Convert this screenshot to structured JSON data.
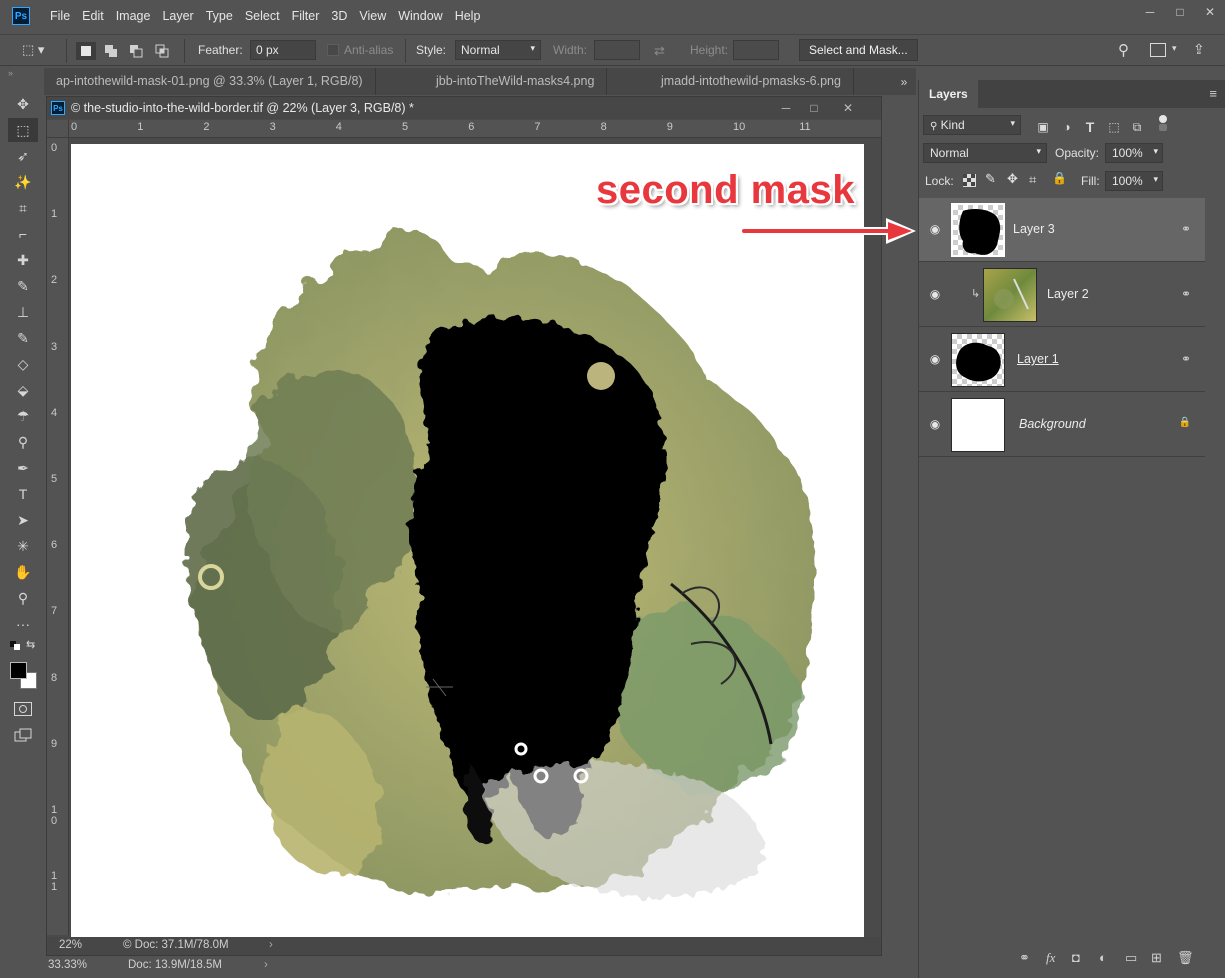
{
  "app": {
    "logo": "Ps",
    "accent": "#31a8ff"
  },
  "menu": [
    "File",
    "Edit",
    "Image",
    "Layer",
    "Type",
    "Select",
    "Filter",
    "3D",
    "View",
    "Window",
    "Help"
  ],
  "window_controls": {
    "minimize": "─",
    "restore": "□",
    "close": "✕"
  },
  "options_bar": {
    "feather_label": "Feather:",
    "feather_value": "0 px",
    "antialias_label": "Anti-alias",
    "style_label": "Style:",
    "style_value": "Normal",
    "width_label": "Width:",
    "height_label": "Height:",
    "select_mask_label": "Select and Mask..."
  },
  "tabs": [
    {
      "label": "ap-intothewild-mask-01.png @ 33.3% (Layer 1, RGB/8)"
    },
    {
      "label": "jbb-intoTheWild-masks4.png"
    },
    {
      "label": "jmadd-intothewild-pmasks-6.png"
    }
  ],
  "tabs_overflow": "»",
  "tools": [
    "move-tool-icon",
    "marquee-tool-icon",
    "lasso-tool-icon",
    "magic-wand-icon",
    "crop-tool-icon",
    "eyedropper-icon",
    "healing-brush-icon",
    "brush-tool-icon",
    "clone-stamp-icon",
    "history-brush-icon",
    "eraser-icon",
    "paint-bucket-icon",
    "blur-tool-icon",
    "dodge-tool-icon",
    "pen-tool-icon",
    "type-tool-icon",
    "path-selection-icon",
    "custom-shape-icon",
    "hand-tool-icon",
    "zoom-tool-icon",
    "more-tools-icon"
  ],
  "tool_glyphs": [
    "✥",
    "⬚",
    "➶",
    "✨",
    "⌗",
    "⌐",
    "✚",
    "✎",
    "⊥",
    "✎",
    "◇",
    "⬙",
    "☂",
    "⚲",
    "✒",
    "T",
    "➤",
    "✳",
    "✋",
    "⚲",
    "···"
  ],
  "document": {
    "title": "© the-studio-into-the-wild-border.tif @ 22% (Layer 3, RGB/8) *",
    "ruler_top": [
      "0",
      "1",
      "2",
      "3",
      "4",
      "5",
      "6",
      "7",
      "8",
      "9",
      "10",
      "11"
    ],
    "ruler_left": [
      "0",
      "1",
      "2",
      "3",
      "4",
      "5",
      "6",
      "7",
      "8",
      "9",
      "10",
      "11"
    ],
    "zoom": "22%",
    "doc_info": "© Doc: 37.1M/78.0M"
  },
  "outer_status": {
    "zoom": "33.33%",
    "doc_info": "Doc: 13.9M/18.5M"
  },
  "layers_panel": {
    "tab": "Layers",
    "menu_icon": "≡",
    "kind_label": "Kind",
    "blend_mode": "Normal",
    "opacity_label": "Opacity:",
    "opacity_value": "100%",
    "lock_label": "Lock:",
    "fill_label": "Fill:",
    "fill_value": "100%",
    "layers": [
      {
        "name": "Layer 3",
        "selected": true,
        "type": "mask",
        "link_icon": "⚭"
      },
      {
        "name": "Layer 2",
        "selected": false,
        "type": "clipped",
        "link_icon": "⚭"
      },
      {
        "name": "Layer 1",
        "selected": false,
        "type": "mask",
        "link_icon": "⚭"
      },
      {
        "name": "Background",
        "selected": false,
        "type": "background",
        "link_icon": "🔒"
      }
    ],
    "bottom_icons": [
      "link-icon",
      "fx-icon",
      "mask-icon",
      "adjustment-icon",
      "group-icon",
      "new-layer-icon",
      "trash-icon"
    ]
  },
  "annotation": {
    "text": "second mask",
    "color": "#e8383d"
  }
}
